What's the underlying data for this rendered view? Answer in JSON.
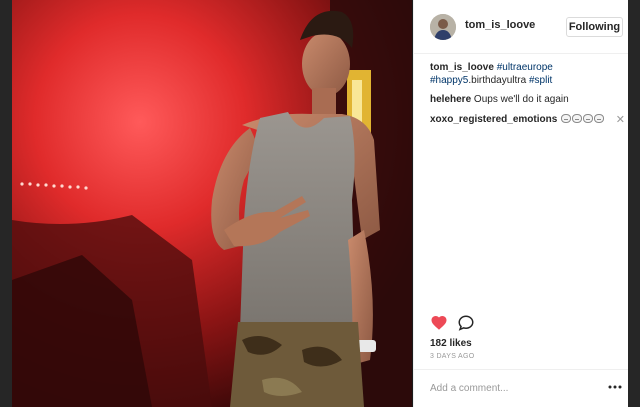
{
  "post": {
    "author": "tom_is_loove",
    "follow_label": "Following"
  },
  "comments": {
    "caption_user": "tom_is_loove",
    "caption_tags": [
      "#ultraeurope",
      "#happy5",
      ".birthdayultra ",
      "#split"
    ],
    "comment1_user": "helehere",
    "comment1_text": "Oups we'll do it again",
    "comment2_user": "xoxo_registered_emotions",
    "comment2_emoji_count": 4
  },
  "actions": {
    "likes": "182 likes",
    "timestamp": "3 DAYS AGO"
  },
  "add_comment": {
    "placeholder": "Add a comment..."
  },
  "icons": [
    "heart-icon",
    "comment-icon",
    "close-icon",
    "more-icon"
  ],
  "colors": {
    "heart": "#ed4956",
    "hashtag": "#003569",
    "photo_accent": "#d92b2b"
  }
}
